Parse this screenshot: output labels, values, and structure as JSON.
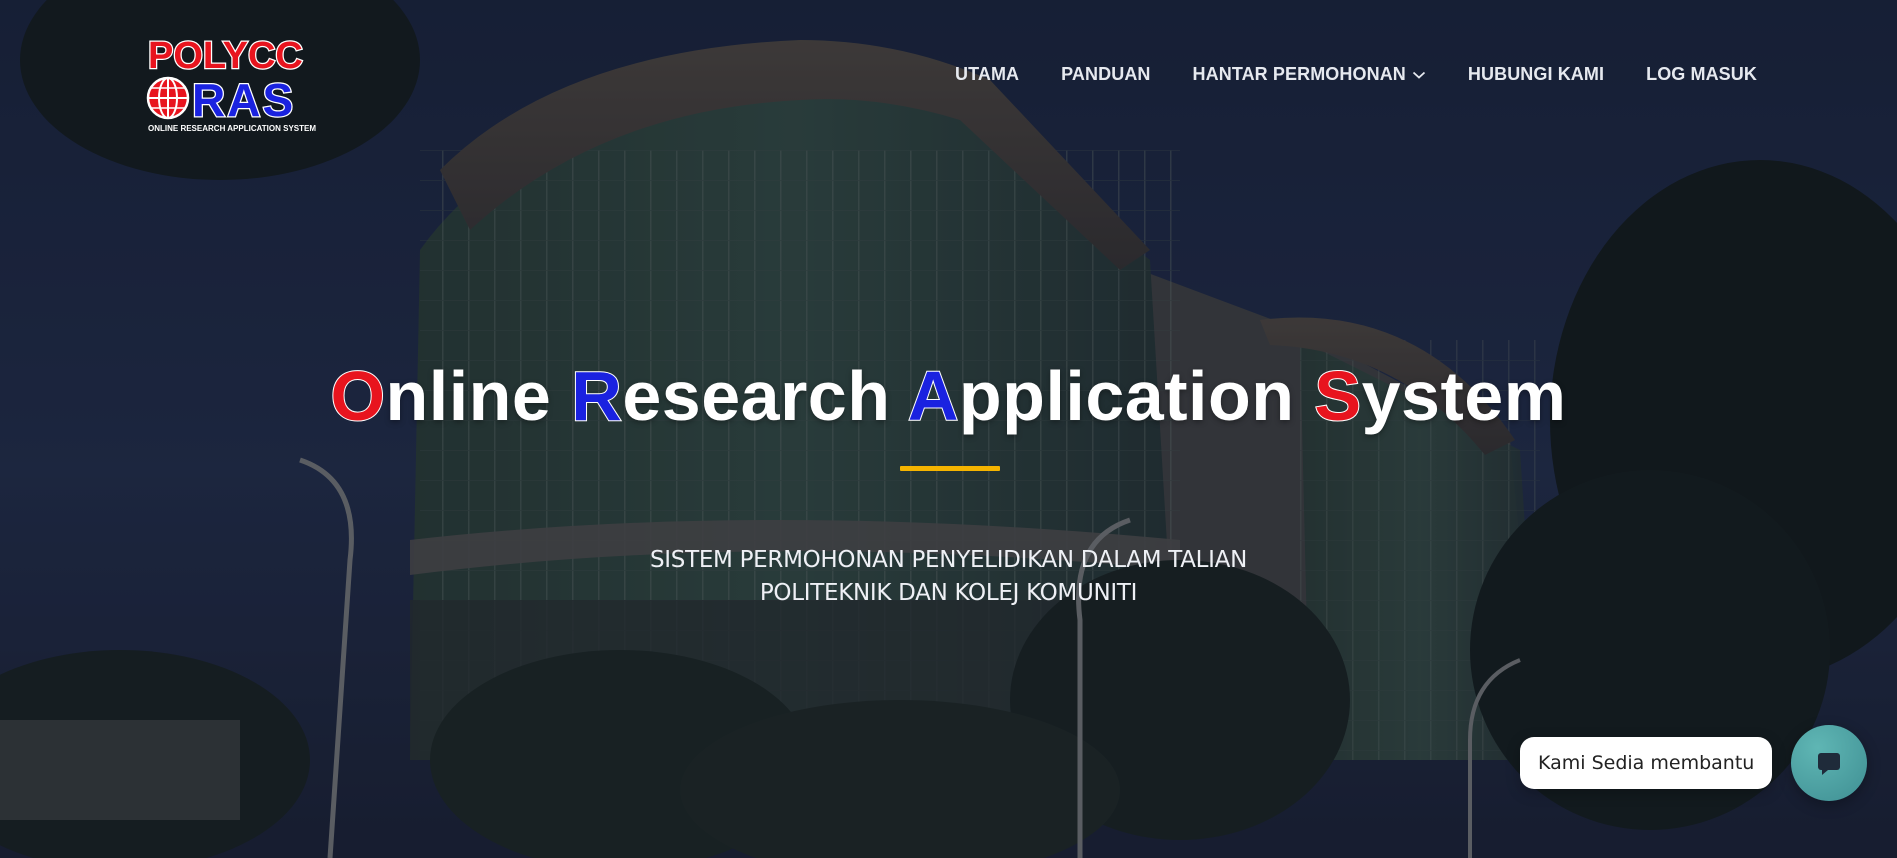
{
  "logo": {
    "line1": "POLYCC",
    "line2": "RAS",
    "tagline": "ONLINE RESEARCH APPLICATION SYSTEM"
  },
  "nav": {
    "items": [
      {
        "label": "UTAMA"
      },
      {
        "label": "PANDUAN"
      },
      {
        "label": "HANTAR PERMOHONAN",
        "has_dropdown": true
      },
      {
        "label": "HUBUNGI KAMI"
      },
      {
        "label": "LOG MASUK"
      }
    ]
  },
  "hero": {
    "headline": {
      "word1_cap": "O",
      "word1_rest": "nline ",
      "word2_cap": "R",
      "word2_rest": "esearch ",
      "word3_cap": "A",
      "word3_rest": "pplication ",
      "word4_cap": "S",
      "word4_rest": "ystem"
    },
    "subtitle_line1": "SISTEM PERMOHONAN PENYELIDIKAN DALAM TALIAN",
    "subtitle_line2": "POLITEKNIK DAN KOLEJ KOMUNITI"
  },
  "chat": {
    "bubble_text": "Kami Sedia membantu",
    "icon": "chat-icon"
  },
  "colors": {
    "accent_red": "#e8141e",
    "accent_blue": "#1a22e0",
    "divider_yellow": "#f5b400",
    "chat_teal": "#4a9fa1"
  }
}
